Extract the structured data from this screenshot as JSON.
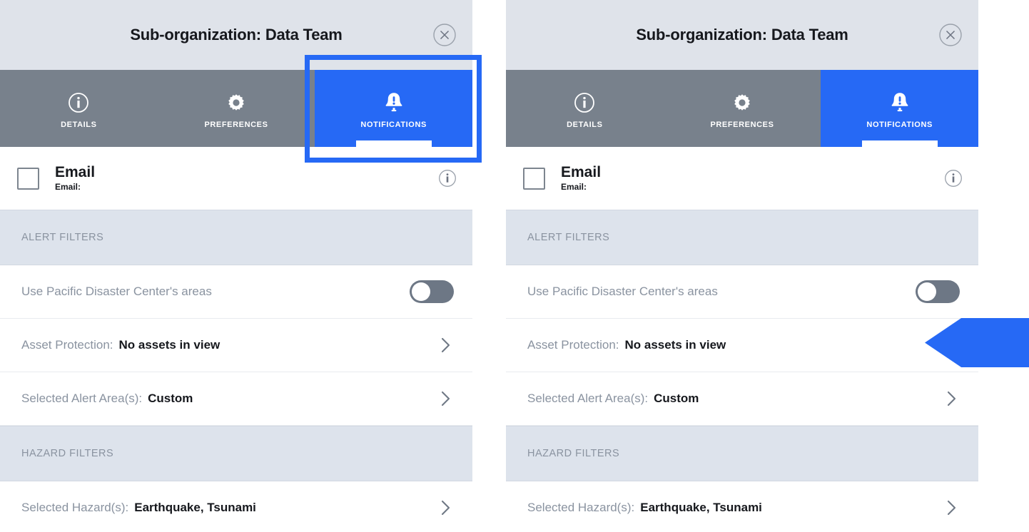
{
  "colors": {
    "accent_blue": "#2669f5",
    "tabbar_gray": "#78818c",
    "titlebar_gray": "#dfe3ea",
    "section_band": "#dde3ec",
    "label_gray": "#8a93a0",
    "value_dark": "#16181d",
    "toggle_track": "#6d7785"
  },
  "panel": {
    "title": "Sub-organization: Data Team",
    "close_icon": "close-circle-icon",
    "tabs": [
      {
        "label": "DETAILS",
        "icon": "info-circle-icon",
        "active": false
      },
      {
        "label": "PREFERENCES",
        "icon": "gear-icon",
        "active": false
      },
      {
        "label": "NOTIFICATIONS",
        "icon": "bell-alert-icon",
        "active": true
      }
    ],
    "email": {
      "checkbox_checked": false,
      "title": "Email",
      "sub_label": "Email:",
      "info_icon": "info-circle-icon"
    },
    "sections": [
      {
        "band_label": "ALERT FILTERS",
        "rows": [
          {
            "type": "toggle",
            "label": "Use Pacific Disaster Center's areas",
            "value": "",
            "toggle_on": false
          },
          {
            "type": "nav",
            "label": "Asset Protection:",
            "value": "No assets in view",
            "chevron_icon": "chevron-right-icon"
          },
          {
            "type": "nav",
            "label": "Selected Alert Area(s):",
            "value": "Custom",
            "chevron_icon": "chevron-right-icon"
          }
        ]
      },
      {
        "band_label": "HAZARD FILTERS",
        "rows": [
          {
            "type": "nav",
            "label": "Selected Hazard(s):",
            "value": "Earthquake, Tsunami",
            "chevron_icon": "chevron-right-icon"
          }
        ]
      }
    ]
  },
  "annotations": {
    "highlight_box": {
      "target": "NOTIFICATIONS",
      "color": "#2669f5"
    },
    "pointer_arrow": {
      "target": "Asset Protection:",
      "color": "#2669f5"
    }
  }
}
